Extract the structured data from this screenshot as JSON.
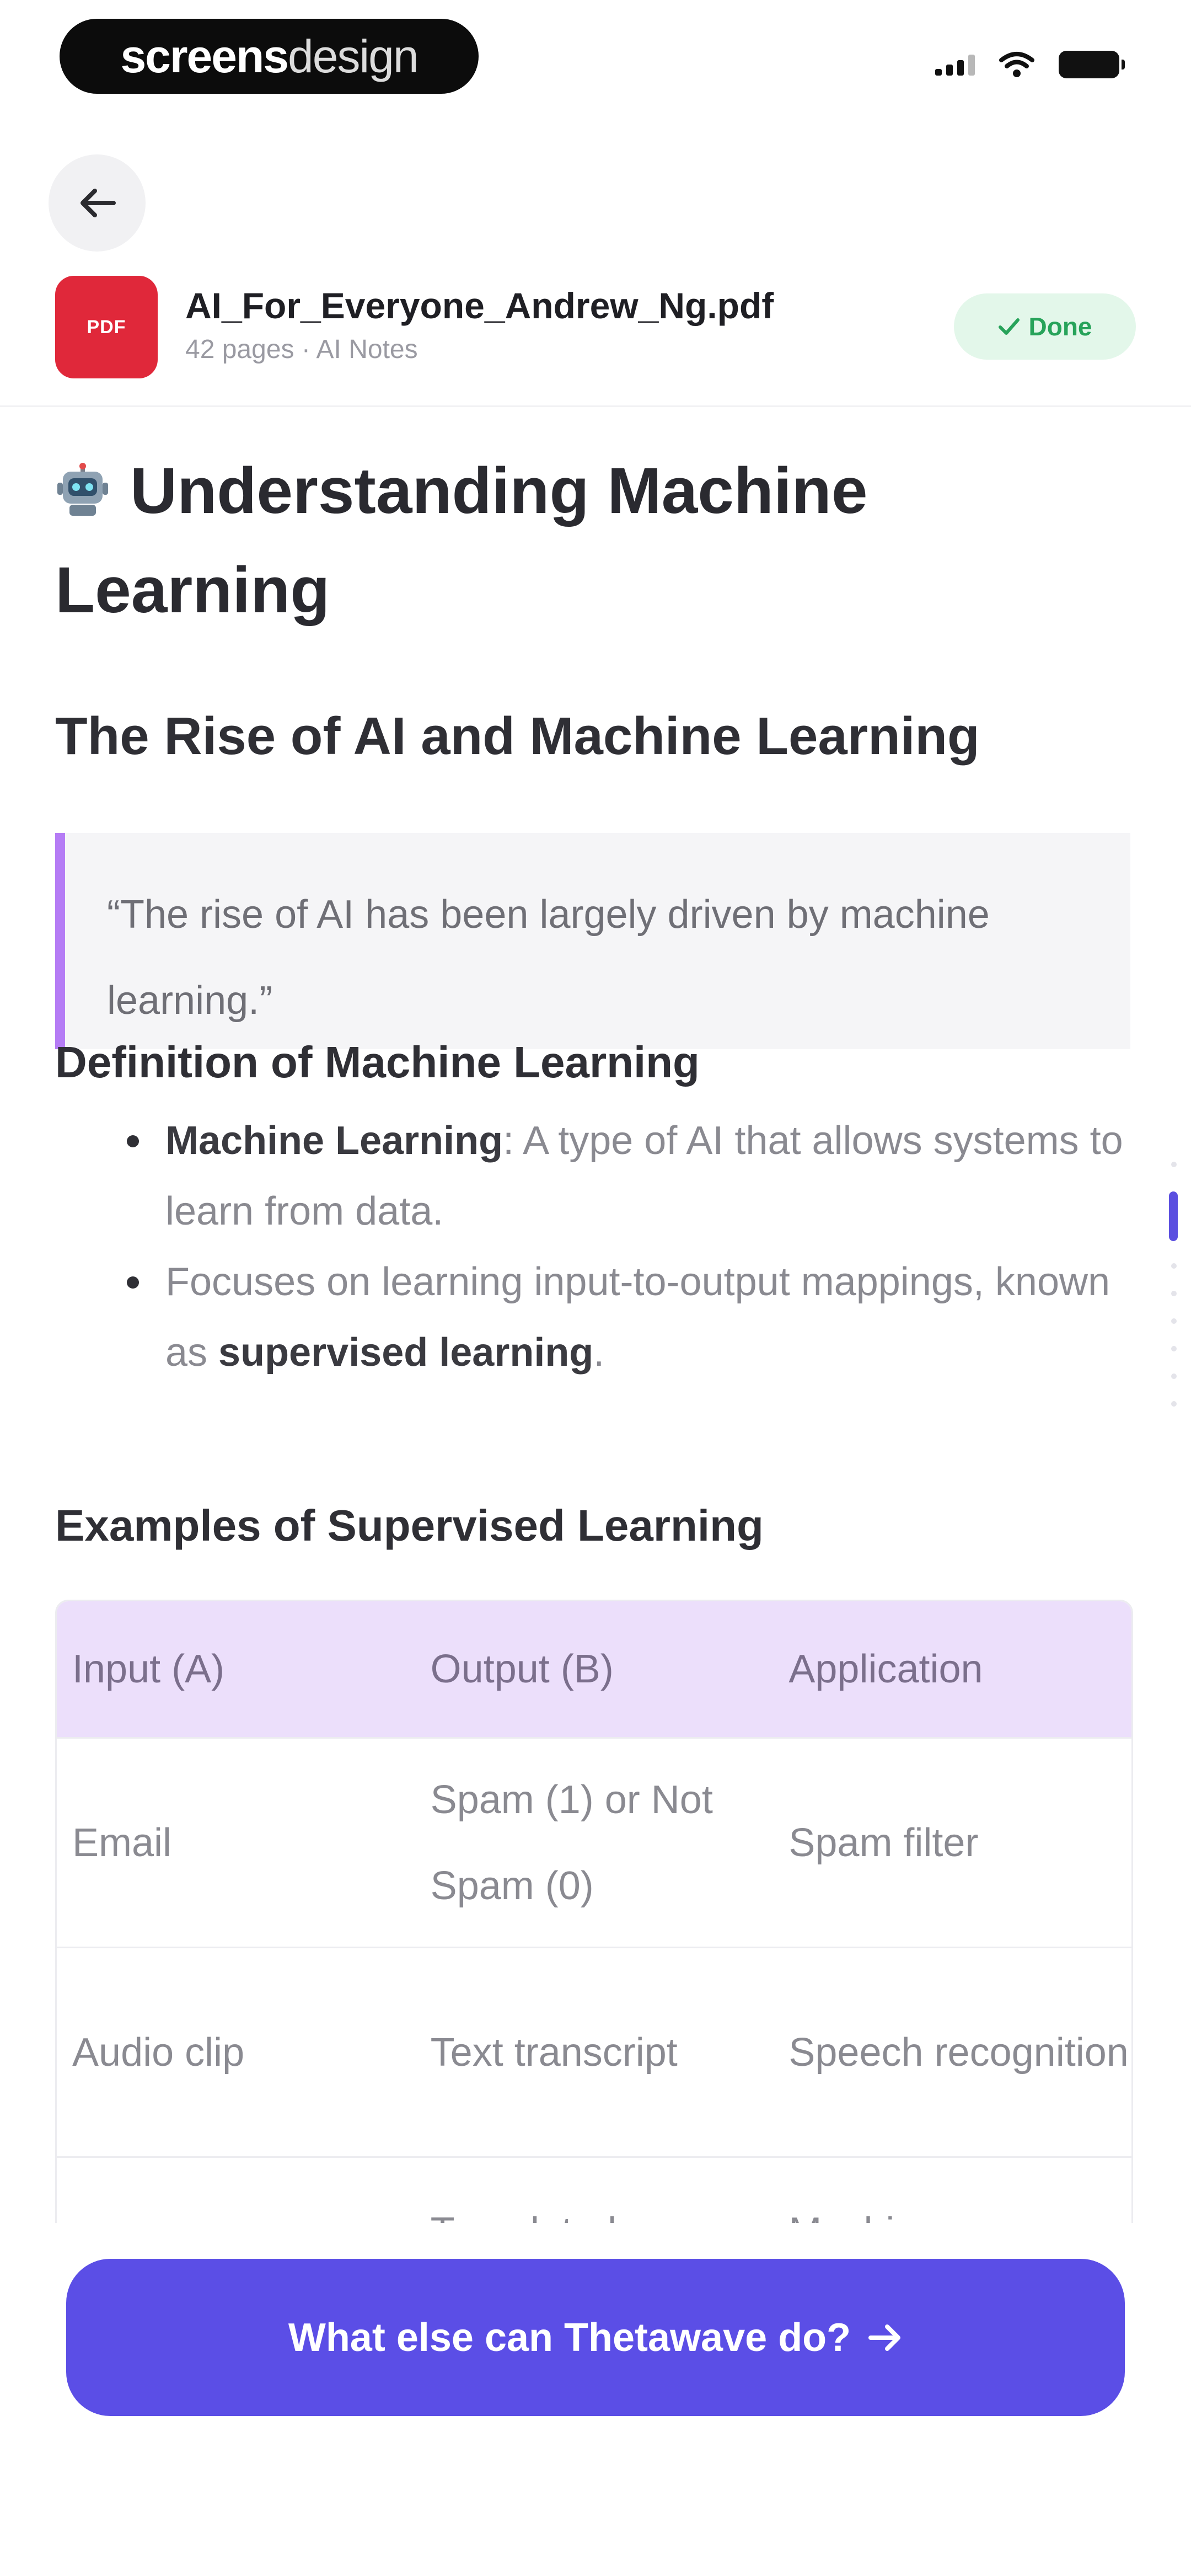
{
  "status_bar": {
    "brand_bold": "screens",
    "brand_light": "design"
  },
  "header": {
    "back_icon": "arrow-left-icon",
    "file": {
      "type_label": "PDF",
      "name": "AI_For_Everyone_Andrew_Ng.pdf",
      "meta": "42 pages · AI Notes"
    },
    "status_badge": {
      "label": "Done",
      "icon": "check-icon",
      "color": "#27a35a"
    }
  },
  "document": {
    "title": "Understanding Machine Learning",
    "title_icon": "robot-icon",
    "section_title": "The Rise of AI and Machine Learning",
    "quote": "“The rise of AI has been largely driven by machine learning.”",
    "definition_heading": "Definition of Machine Learning",
    "bullets": [
      {
        "bold": "Machine Learning",
        "text": ": A type of AI that allows systems to learn from data."
      },
      {
        "text": "Focuses on learning input-to-output mappings, known as ",
        "bold_end": "supervised learning",
        "end": "."
      }
    ],
    "examples_heading": "Examples of Supervised Learning",
    "table": {
      "headers": [
        "Input (A)",
        "Output (B)",
        "Application"
      ],
      "rows": [
        [
          "Email",
          "Spam (1) or Not Spam (0)",
          "Spam filter"
        ],
        [
          "Audio clip",
          "Text transcript",
          "Speech recognition"
        ],
        [
          "",
          "Translated",
          "Machine"
        ]
      ]
    }
  },
  "cta": {
    "label": "What else can Thetawave do?",
    "icon": "arrow-right-icon",
    "color": "#5b4ee6"
  },
  "colors": {
    "accent": "#5b4ee6",
    "quote_bar": "#b57cf5",
    "table_header_bg": "#ecdffb",
    "pdf_red": "#e0283a"
  }
}
